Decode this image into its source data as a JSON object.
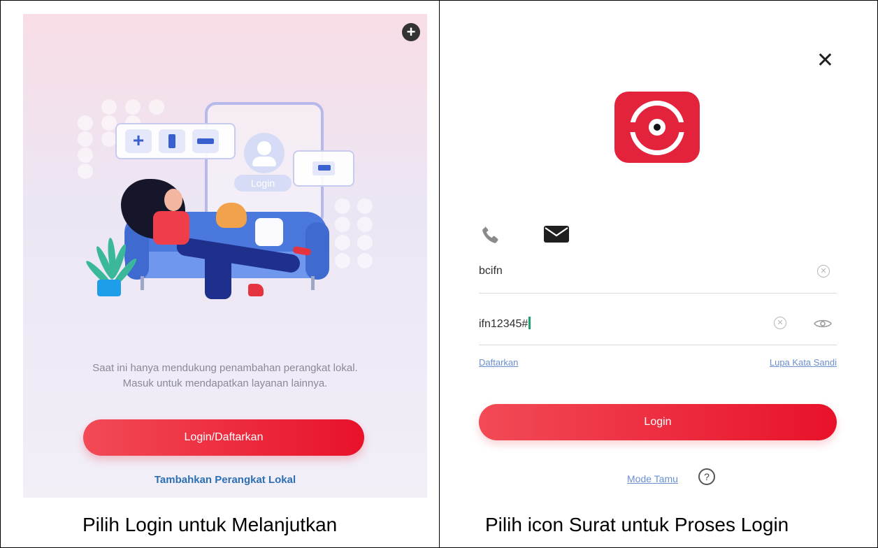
{
  "left_panel": {
    "add_icon": "plus-circle-icon",
    "illustration": {
      "login_pill": "Login"
    },
    "info_text": {
      "line1": "Saat ini hanya mendukung penambahan perangkat lokal.",
      "line2": "Masuk untuk mendapatkan layanan lainnya."
    },
    "login_button": "Login/Daftarkan",
    "add_local_link": "Tambahkan Perangkat Lokal",
    "caption": "Pilih Login untuk Melanjutkan",
    "colors": {
      "accent": "#e8122a",
      "link": "#2d6fb3"
    }
  },
  "right_panel": {
    "close_icon": "close-icon",
    "logo_icon": "app-logo-icon",
    "login_tabs": [
      {
        "icon": "phone-icon"
      },
      {
        "icon": "mail-icon"
      }
    ],
    "username": {
      "value": "bcifn"
    },
    "password": {
      "value": "ifn12345#"
    },
    "register_link": "Daftarkan",
    "forgot_link": "Lupa Kata Sandi",
    "login_button": "Login",
    "guest_link": "Mode Tamu",
    "help_icon": "question-circle-icon",
    "help_symbol": "?",
    "caption": "Pilih icon Surat untuk Proses Login",
    "colors": {
      "accent": "#e3233b",
      "link": "#6b8fcd"
    }
  }
}
